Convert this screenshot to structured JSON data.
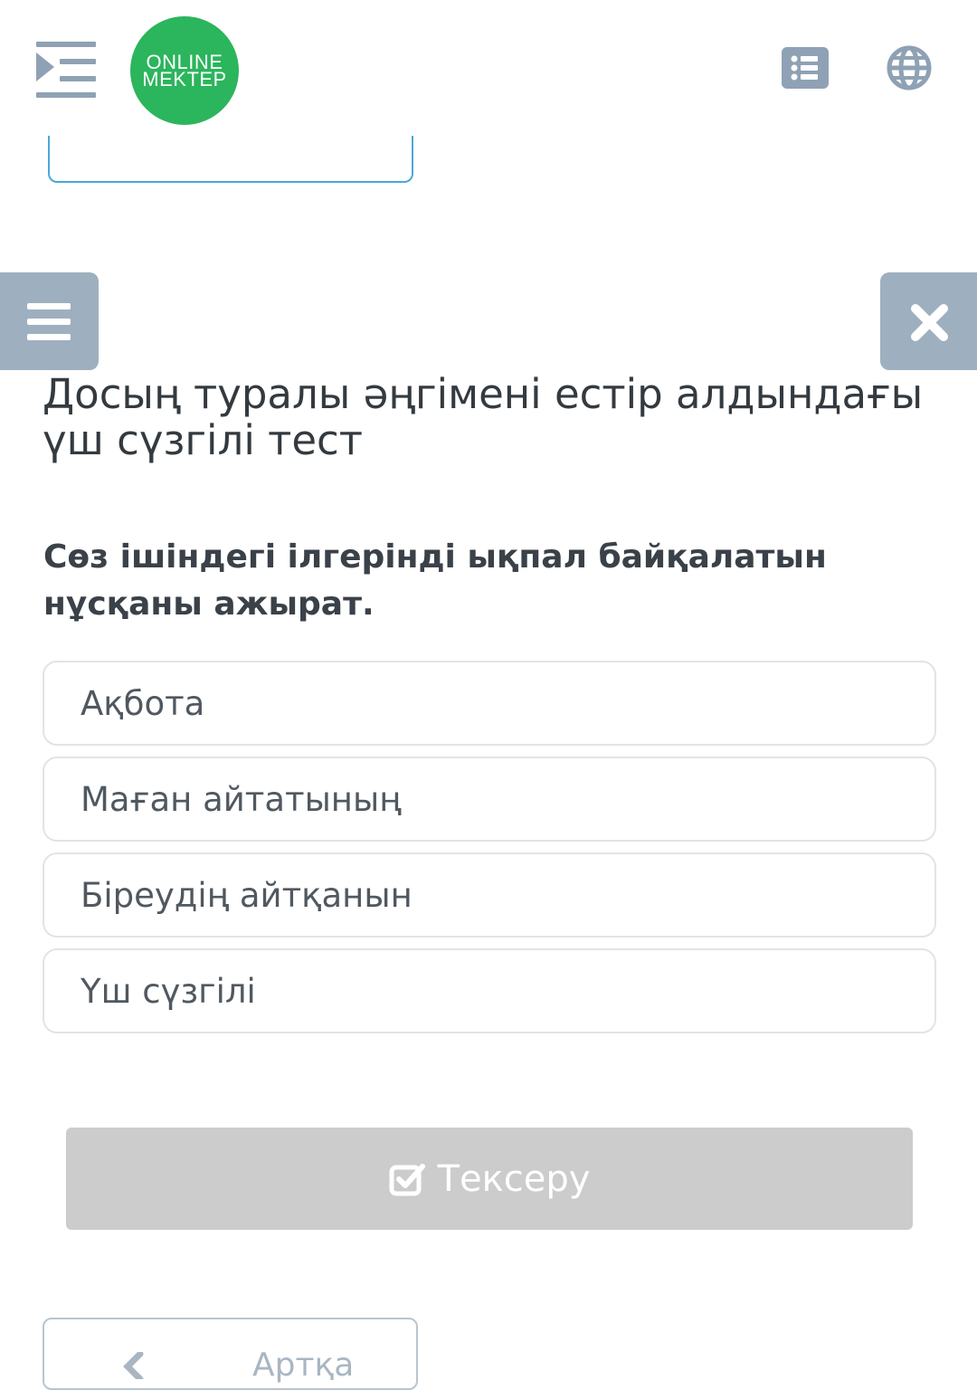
{
  "header": {
    "logo_line1": "ONLINE",
    "logo_line2": "MEKTEP",
    "menu_icon": "indent-menu-icon",
    "list_icon": "list-icon",
    "globe_icon": "globe-icon"
  },
  "test": {
    "title": "Досың туралы әңгімені естір алдындағы үш сүзгілі тест"
  },
  "question": {
    "text": "Сөз ішіндегі ілгерінді ықпал байқалатын нұсқаны ажырат.",
    "options": [
      {
        "label": "Ақбота"
      },
      {
        "label": "Маған айтатының"
      },
      {
        "label": "Біреудің айтқанын"
      },
      {
        "label": "Үш сүзгілі"
      }
    ]
  },
  "actions": {
    "check_label": "Тексеру",
    "back_label": "Артқа"
  },
  "colors": {
    "accent_gray": "#9eb0bf",
    "logo_green": "#2bb55c",
    "check_disabled": "#cccccc"
  }
}
